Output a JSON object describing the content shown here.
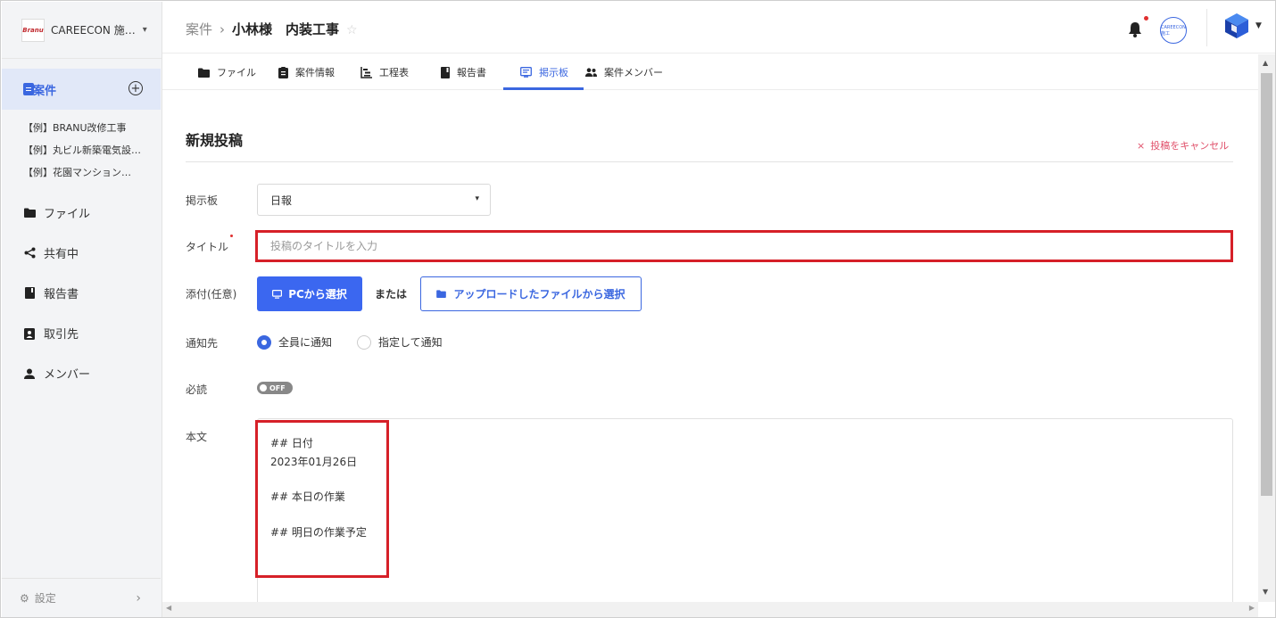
{
  "org": {
    "logo_text": "Branu",
    "name": "CAREECON 施…",
    "chevron": "⌄"
  },
  "sidebar": {
    "active_item": {
      "label": "案件",
      "icon": "clipboard-icon"
    },
    "add_symbol": "+",
    "projects": [
      {
        "label": "【例】BRANU改修工事"
      },
      {
        "label": "【例】丸ビル新築電気設…"
      },
      {
        "label": "【例】花園マンション…"
      }
    ],
    "items": [
      {
        "label": "ファイル",
        "icon": "folder-icon"
      },
      {
        "label": "共有中",
        "icon": "share-icon"
      },
      {
        "label": "報告書",
        "icon": "book-icon"
      },
      {
        "label": "取引先",
        "icon": "contact-card-icon"
      },
      {
        "label": "メンバー",
        "icon": "person-icon"
      }
    ],
    "settings_label": "設定",
    "settings_arrow": "›"
  },
  "header": {
    "breadcrumb_root": "案件",
    "breadcrumb_sep": "›",
    "breadcrumb_current": "小林様　内装工事",
    "star": "☆",
    "avatar_text": "CAREECON施工",
    "notification_dot_color": "#e03030"
  },
  "tabs": [
    {
      "label": "ファイル",
      "icon": "folder-icon"
    },
    {
      "label": "案件情報",
      "icon": "clipboard-icon"
    },
    {
      "label": "工程表",
      "icon": "gantt-icon"
    },
    {
      "label": "報告書",
      "icon": "book-icon"
    },
    {
      "label": "掲示板",
      "icon": "board-icon",
      "active": true
    },
    {
      "label": "案件メンバー",
      "icon": "people-icon"
    }
  ],
  "form": {
    "title": "新規投稿",
    "cancel_symbol": "×",
    "cancel_label": "投稿をキャンセル",
    "board_label": "掲示板",
    "board_value": "日報",
    "board_chevron": "⌄",
    "title_label": "タイトル",
    "title_placeholder": "投稿のタイトルを入力",
    "title_value": "",
    "attach_label": "添付(任意)",
    "pc_button": "PCから選択",
    "or_text": "または",
    "uploaded_button": "アップロードしたファイルから選択",
    "notify_label": "通知先",
    "notify_options": [
      {
        "label": "全員に通知",
        "selected": true
      },
      {
        "label": "指定して通知",
        "selected": false
      }
    ],
    "required_label": "必読",
    "required_toggle": "OFF",
    "body_label": "本文",
    "body_lines": [
      "## 日付",
      "2023年01月26日",
      "## 本日の作業",
      "## 明日の作業予定"
    ]
  },
  "colors": {
    "accent": "#3b67e0",
    "highlight": "#d62028",
    "cancel": "#e0506a"
  }
}
